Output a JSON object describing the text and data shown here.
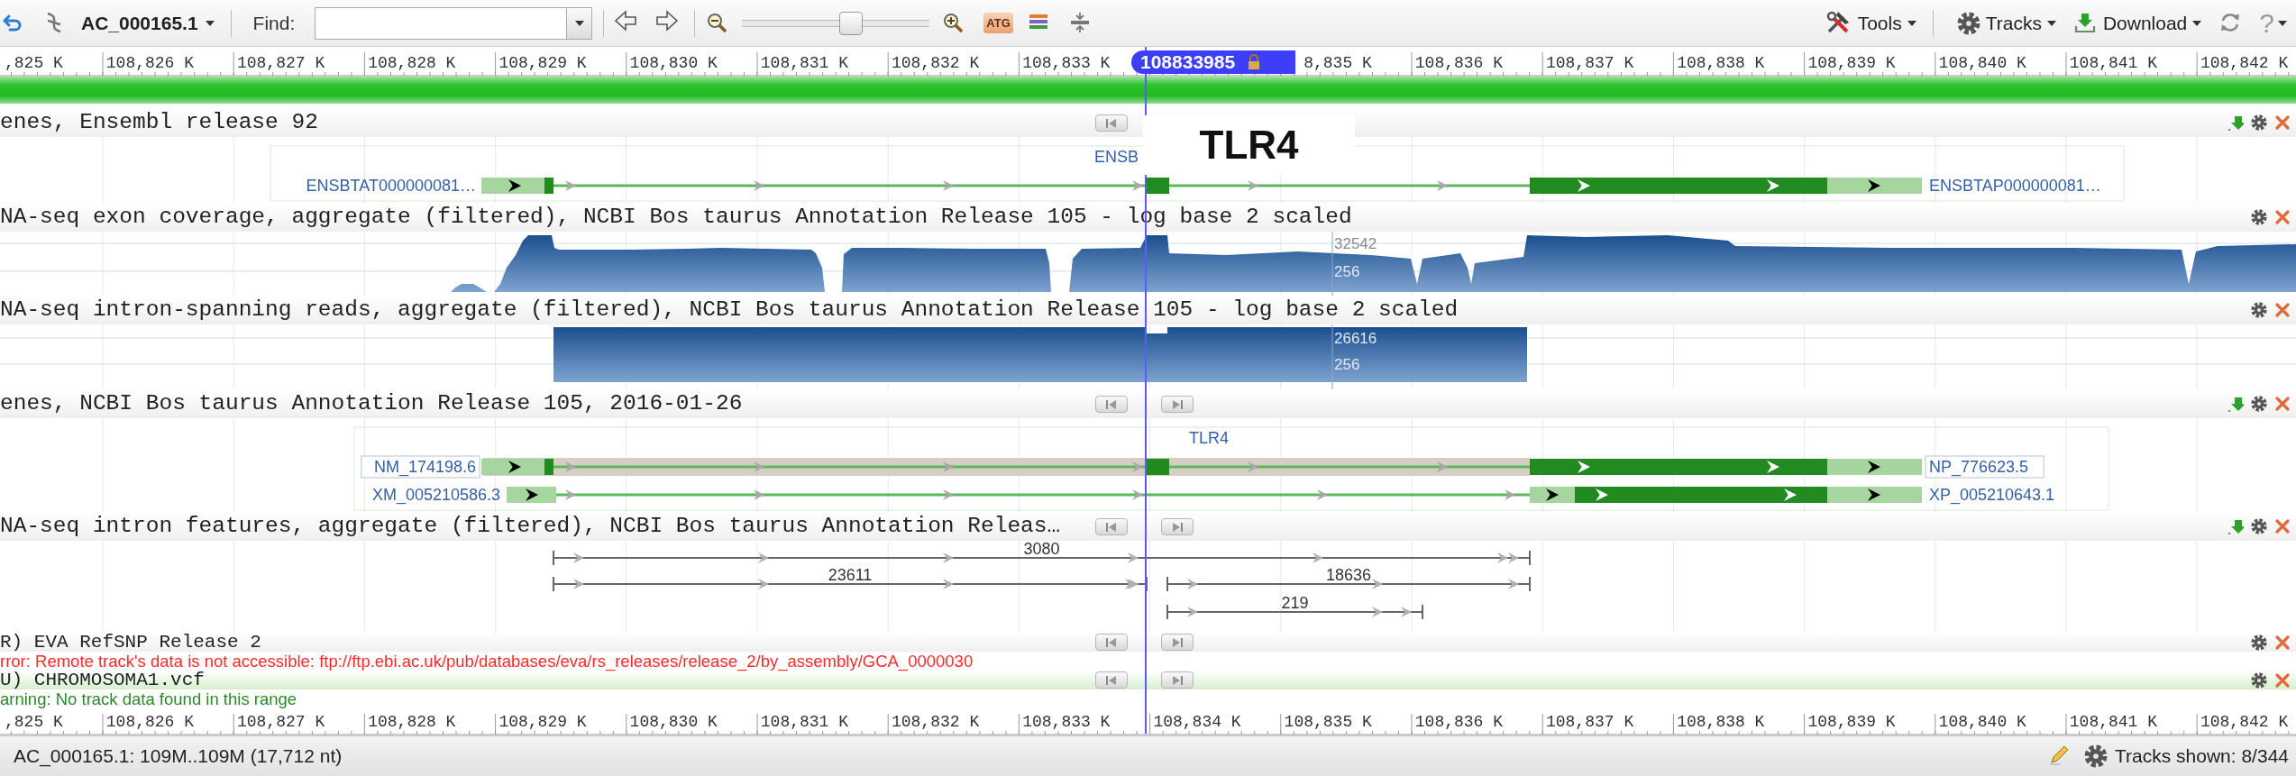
{
  "toolbar": {
    "sequence": "AC_000165.1",
    "find_label": "Find:",
    "zoom": {
      "level": 0.58
    },
    "sequence_view": "ATG",
    "menus": [
      {
        "label": "Tools",
        "kind": "tools"
      },
      {
        "label": "Tracks",
        "kind": "settings"
      },
      {
        "label": "Download",
        "kind": "download"
      }
    ],
    "help": "?"
  },
  "ruler": {
    "ticks": [
      ",825 K",
      "108,826 K",
      "108,827 K",
      "108,828 K",
      "108,829 K",
      "108,830 K",
      "108,831 K",
      "108,832 K",
      "108,833 K",
      "8,835 K",
      "108,836 K",
      "108,837 K",
      "108,838 K",
      "108,839 K",
      "108,840 K",
      "108,841 K",
      "108,842 K"
    ],
    "marker": "108833985"
  },
  "annotation": "TLR4",
  "tracks": [
    {
      "kind": "genes",
      "title": "enes, Ensembl release 92",
      "nav": [
        {
          "kind": "back"
        }
      ],
      "actions": [
        {
          "kind": "download"
        },
        {
          "kind": "settings"
        },
        {
          "kind": "close"
        }
      ],
      "gene_label": "ENSB",
      "transcripts": [
        {
          "label": "ENSBTAT000000081…",
          "protein": "ENSBTAP000000081…",
          "selected": false
        }
      ]
    },
    {
      "kind": "exon_coverage",
      "title": "NA-seq exon coverage, aggregate (filtered), NCBI Bos taurus Annotation Release 105 - log base 2 scaled",
      "actions": [
        {
          "kind": "settings"
        },
        {
          "kind": "close"
        }
      ],
      "scale": [
        "32542",
        "256"
      ]
    },
    {
      "kind": "intron_coverage",
      "title": "NA-seq intron-spanning reads, aggregate (filtered), NCBI Bos taurus Annotation Release 105 - log base 2 scaled",
      "actions": [
        {
          "kind": "settings"
        },
        {
          "kind": "close"
        }
      ],
      "scale": [
        "26616",
        "256"
      ]
    },
    {
      "kind": "genes",
      "title": "enes, NCBI Bos taurus Annotation Release 105, 2016-01-26",
      "nav": [
        {
          "kind": "back"
        },
        {
          "kind": "forward"
        }
      ],
      "actions": [
        {
          "kind": "download"
        },
        {
          "kind": "settings"
        },
        {
          "kind": "close"
        }
      ],
      "gene_label": "TLR4",
      "transcripts": [
        {
          "label": "NM_174198.6",
          "protein": "NP_776623.5",
          "selected": true
        },
        {
          "label": "XM_005210586.3",
          "protein": "XP_005210643.1",
          "selected": false
        }
      ]
    },
    {
      "kind": "intron_features",
      "title": "NA-seq intron features, aggregate (filtered), NCBI Bos taurus Annotation Releas…",
      "nav": [
        {
          "kind": "back"
        },
        {
          "kind": "forward"
        }
      ],
      "actions": [
        {
          "kind": "download"
        },
        {
          "kind": "settings"
        },
        {
          "kind": "close"
        }
      ],
      "spans": [
        "3080",
        "23611",
        "18636",
        "219"
      ]
    },
    {
      "kind": "variants",
      "title": "R) EVA RefSNP Release 2",
      "nav": [
        {
          "kind": "back"
        },
        {
          "kind": "forward"
        }
      ],
      "actions": [
        {
          "kind": "settings"
        },
        {
          "kind": "close"
        }
      ],
      "message": {
        "kind": "error",
        "text": "rror: Remote track's data is not accessible: ftp://ftp.ebi.ac.uk/pub/databases/eva/rs_releases/release_2/by_assembly/GCA_0000030"
      }
    },
    {
      "kind": "variants",
      "title": "U) CHROMOSOMA1.vcf",
      "nav": [
        {
          "kind": "back"
        },
        {
          "kind": "forward"
        }
      ],
      "actions": [
        {
          "kind": "settings"
        },
        {
          "kind": "close"
        }
      ],
      "message": {
        "kind": "warning",
        "text": "arning: No track data found in this range"
      }
    }
  ],
  "bottom_ruler": {
    "ticks": [
      ",825 K",
      "108,826 K",
      "108,827 K",
      "108,828 K",
      "108,829 K",
      "108,830 K",
      "108,831 K",
      "108,832 K",
      "108,833 K",
      "108,834 K",
      "108,835 K",
      "108,836 K",
      "108,837 K",
      "108,838 K",
      "108,839 K",
      "108,840 K",
      "108,841 K",
      "108,842 K"
    ]
  },
  "status_bar": {
    "location": "AC_000165.1: 109M..109M (17,712 nt)",
    "tracks_shown": "Tracks shown: 8/344"
  }
}
